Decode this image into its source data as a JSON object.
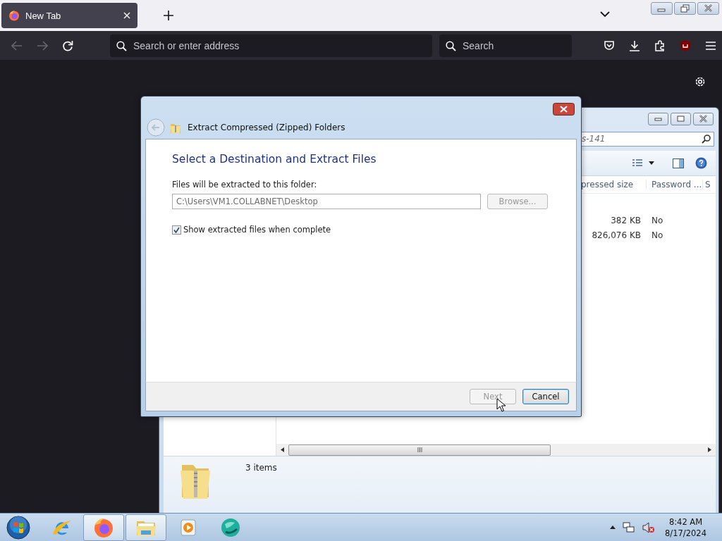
{
  "browser": {
    "tabs": [
      {
        "label": "New Tab",
        "selected": true
      }
    ],
    "back_disabled": true,
    "forward_disabled": true,
    "address": {
      "placeholder": "Search or enter address"
    },
    "search": {
      "placeholder": "Search"
    }
  },
  "explorer": {
    "search": {
      "value": "s-141"
    },
    "columns": [
      "pressed size",
      "Password ...",
      "S"
    ],
    "rows": [
      {
        "size": "382 KB",
        "password": "No"
      },
      {
        "size": "826,076 KB",
        "password": "No"
      }
    ],
    "status": "3 items"
  },
  "dialog": {
    "title": "Extract Compressed (Zipped) Folders",
    "heading": "Select a Destination and Extract Files",
    "path_label": "Files will be extracted to this folder:",
    "path": {
      "value": "C:\\Users\\VM1.COLLABNET\\Desktop",
      "disabled": true
    },
    "browse": {
      "label": "Browse...",
      "disabled": true
    },
    "show_files": {
      "label": "Show extracted files when complete",
      "checked": true
    },
    "buttons": [
      {
        "label": "Next",
        "disabled": true
      },
      {
        "label": "Cancel",
        "disabled": false
      }
    ]
  },
  "taskbar": {
    "apps": [
      {
        "kind": "ie",
        "active": false
      },
      {
        "kind": "firefox",
        "active": true
      },
      {
        "kind": "explorer",
        "active": true
      },
      {
        "kind": "media",
        "active": false
      },
      {
        "kind": "globe",
        "active": false
      }
    ],
    "time": "8:42 AM",
    "date": "8/17/2024"
  }
}
